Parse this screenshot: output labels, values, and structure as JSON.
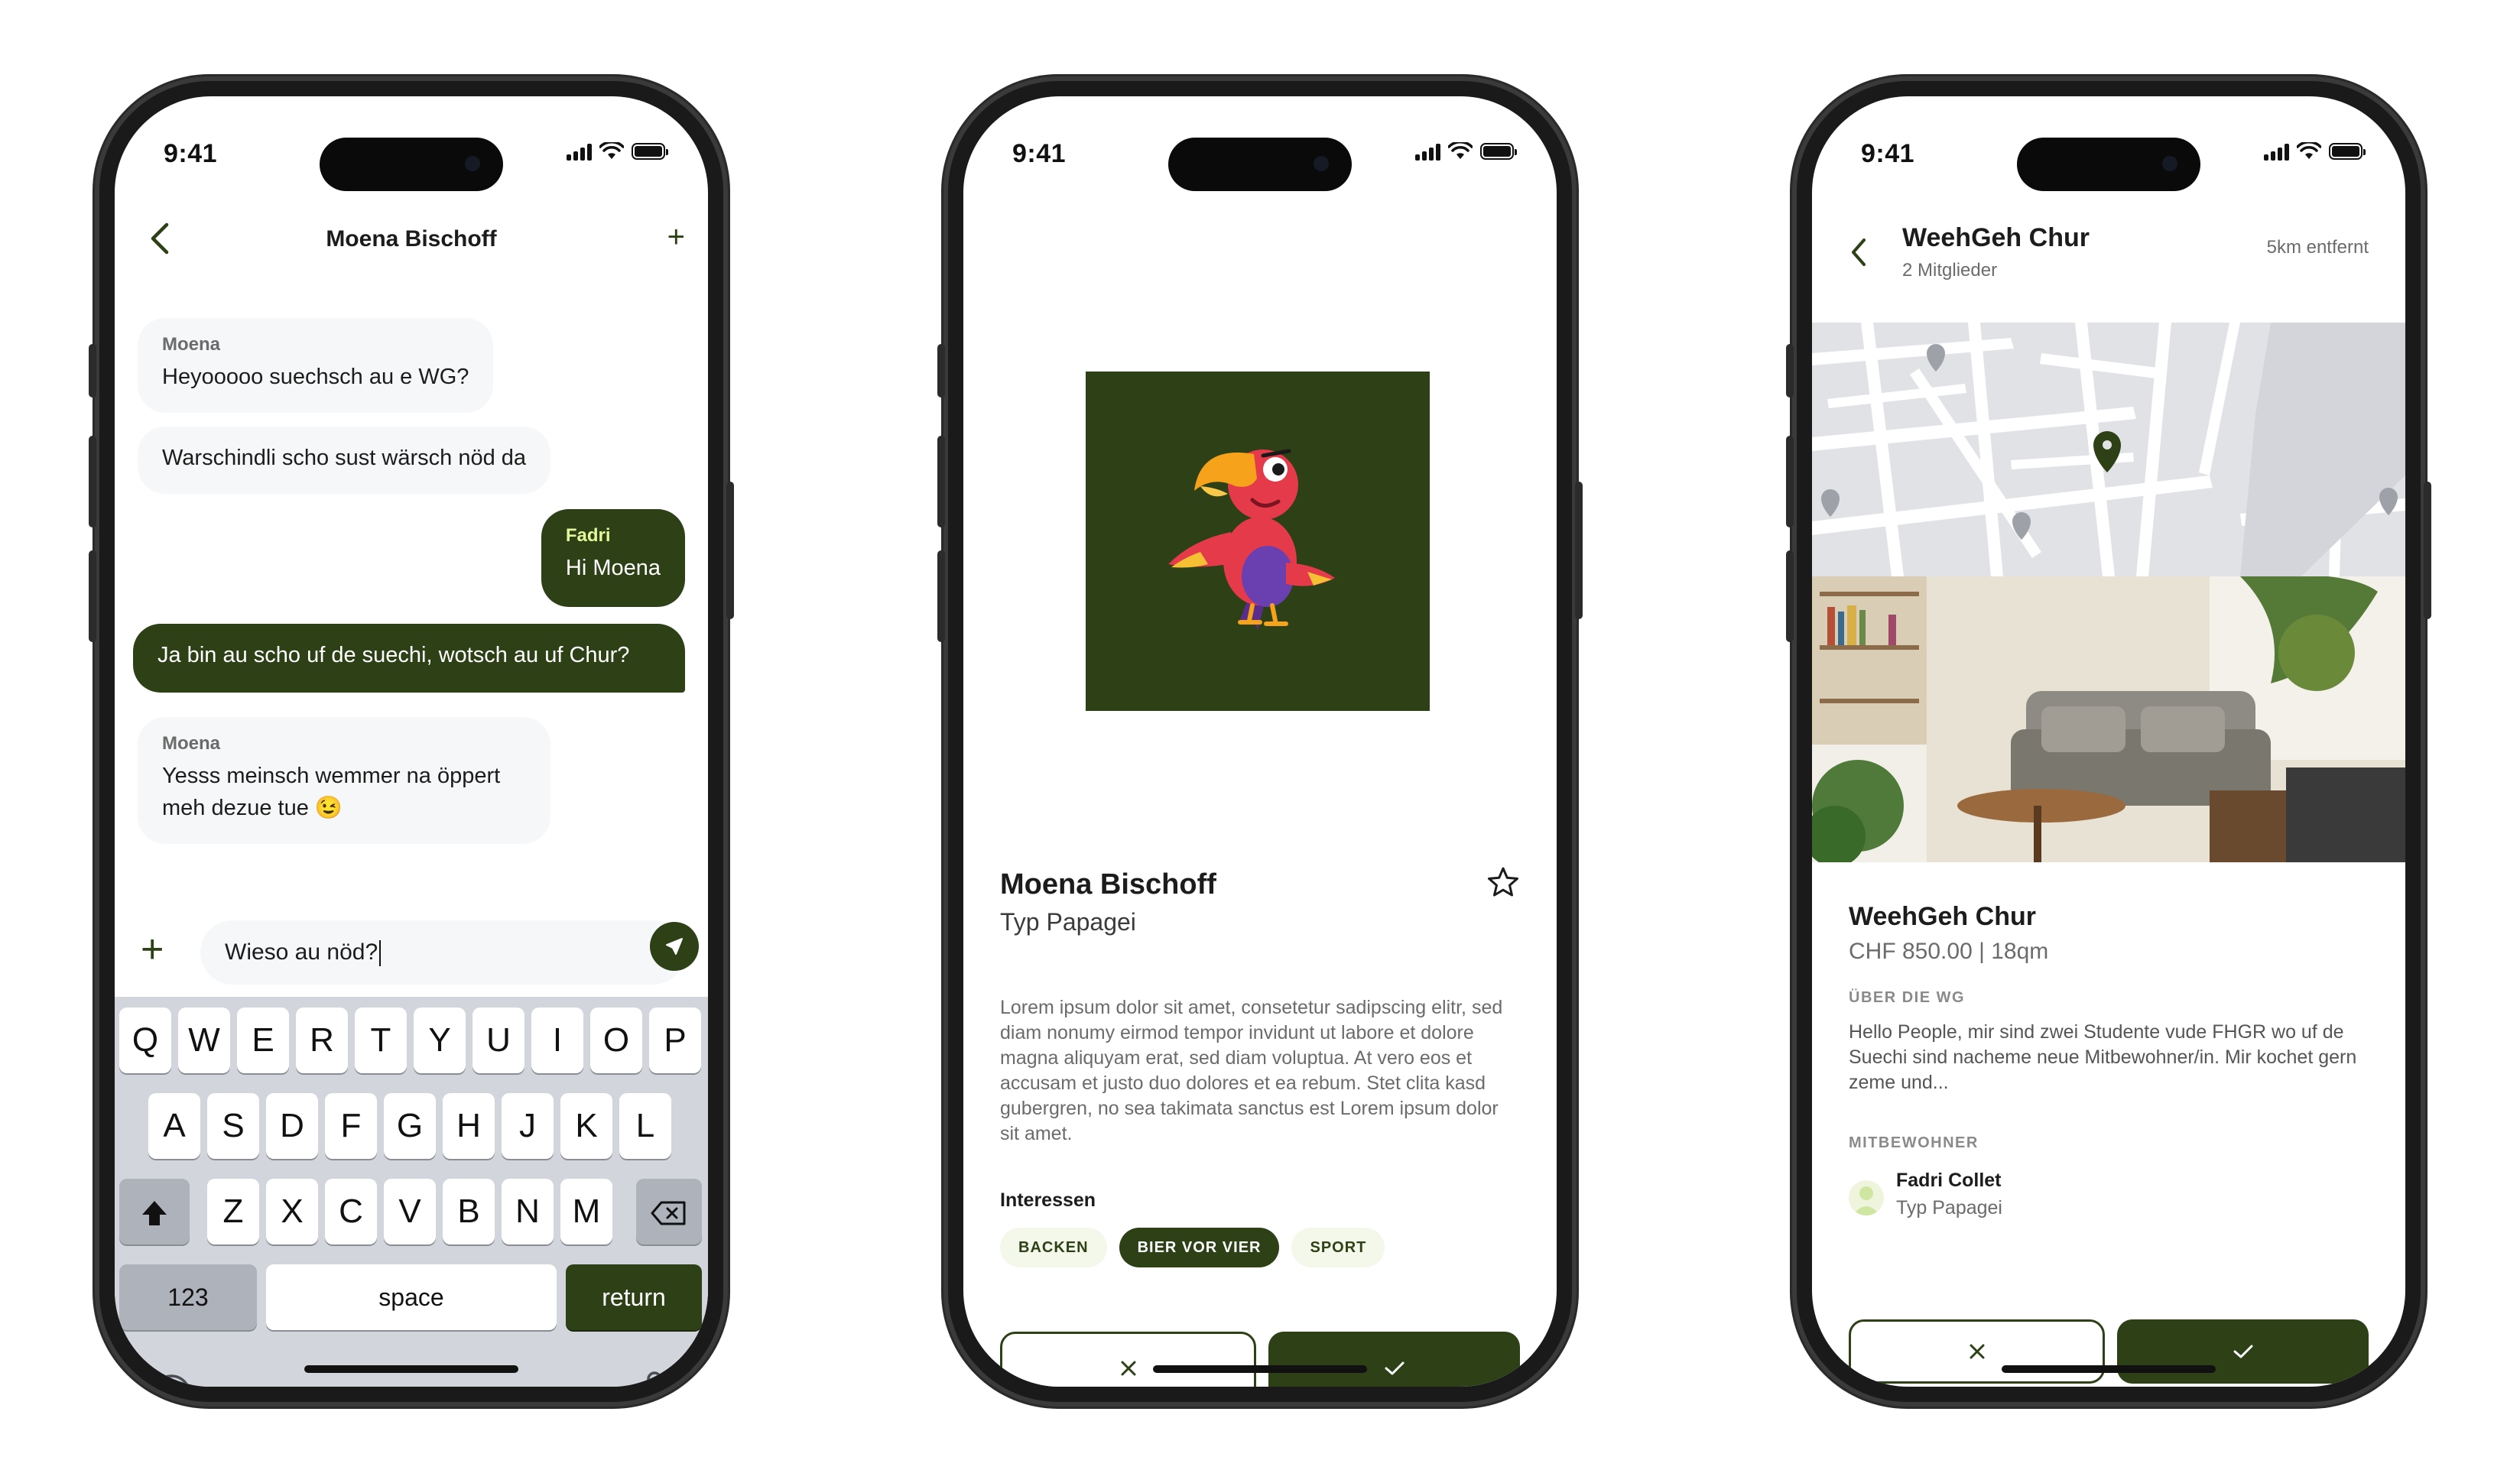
{
  "colors": {
    "primary": "#2d4016",
    "accent_light": "#e4f79b",
    "bubble_in": "#f6f7f9",
    "chip_bg": "#f3f8ea"
  },
  "status": {
    "time": "9:41"
  },
  "chat": {
    "header_title": "Moena Bischoff",
    "messages": [
      {
        "direction": "in",
        "sender": "Moena",
        "text": "Heyooooo suechsch au e WG?"
      },
      {
        "direction": "in",
        "sender": "",
        "text": "Warschindli scho sust wärsch nöd da"
      },
      {
        "direction": "out",
        "sender": "Fadri",
        "text": "Hi Moena"
      },
      {
        "direction": "out",
        "sender": "",
        "text": "Ja bin au scho uf de suechi, wotsch au uf Chur?"
      },
      {
        "direction": "in",
        "sender": "Moena",
        "text": "Yesss meinsch wemmer na öppert meh dezue tue 😉"
      }
    ],
    "input_value": "Wieso au nöd?",
    "keyboard": {
      "row1": [
        "Q",
        "W",
        "E",
        "R",
        "T",
        "Y",
        "U",
        "I",
        "O",
        "P"
      ],
      "row2": [
        "A",
        "S",
        "D",
        "F",
        "G",
        "H",
        "J",
        "K",
        "L"
      ],
      "row3": [
        "Z",
        "X",
        "C",
        "V",
        "B",
        "N",
        "M"
      ],
      "numbers_label": "123",
      "space_label": "space",
      "return_label": "return"
    }
  },
  "profile": {
    "name": "Moena Bischoff",
    "type": "Typ Papagei",
    "description": "Lorem ipsum dolor sit amet, consetetur sadipscing elitr, sed diam nonumy eirmod tempor invidunt ut labore et dolore magna aliquyam erat, sed diam voluptua. At vero eos et accusam et justo duo dolores et ea rebum. Stet clita kasd gubergren, no sea takimata sanctus est Lorem ipsum dolor sit amet.",
    "interests_title": "Interessen",
    "interests": [
      {
        "label": "BACKEN",
        "active": false
      },
      {
        "label": "BIER VOR VIER",
        "active": true
      },
      {
        "label": "SPORT",
        "active": false
      }
    ],
    "reject_icon": "close-icon",
    "accept_icon": "check-icon"
  },
  "wg": {
    "title": "WeehGeh Chur",
    "members": "2 Mitglieder",
    "distance": "5km entfernt",
    "name": "WeehGeh Chur",
    "price": "CHF 850.00 | 18qm",
    "about_label": "ÜBER DIE WG",
    "about_text": "Hello People, mir sind zwei Studente vude FHGR wo uf de Suechi sind nacheme neue Mitbewohner/in. Mir kochet gern zeme und...",
    "mates_label": "MITBEWOHNER",
    "mate_name": "Fadri Collet",
    "mate_type": "Typ Papagei"
  }
}
